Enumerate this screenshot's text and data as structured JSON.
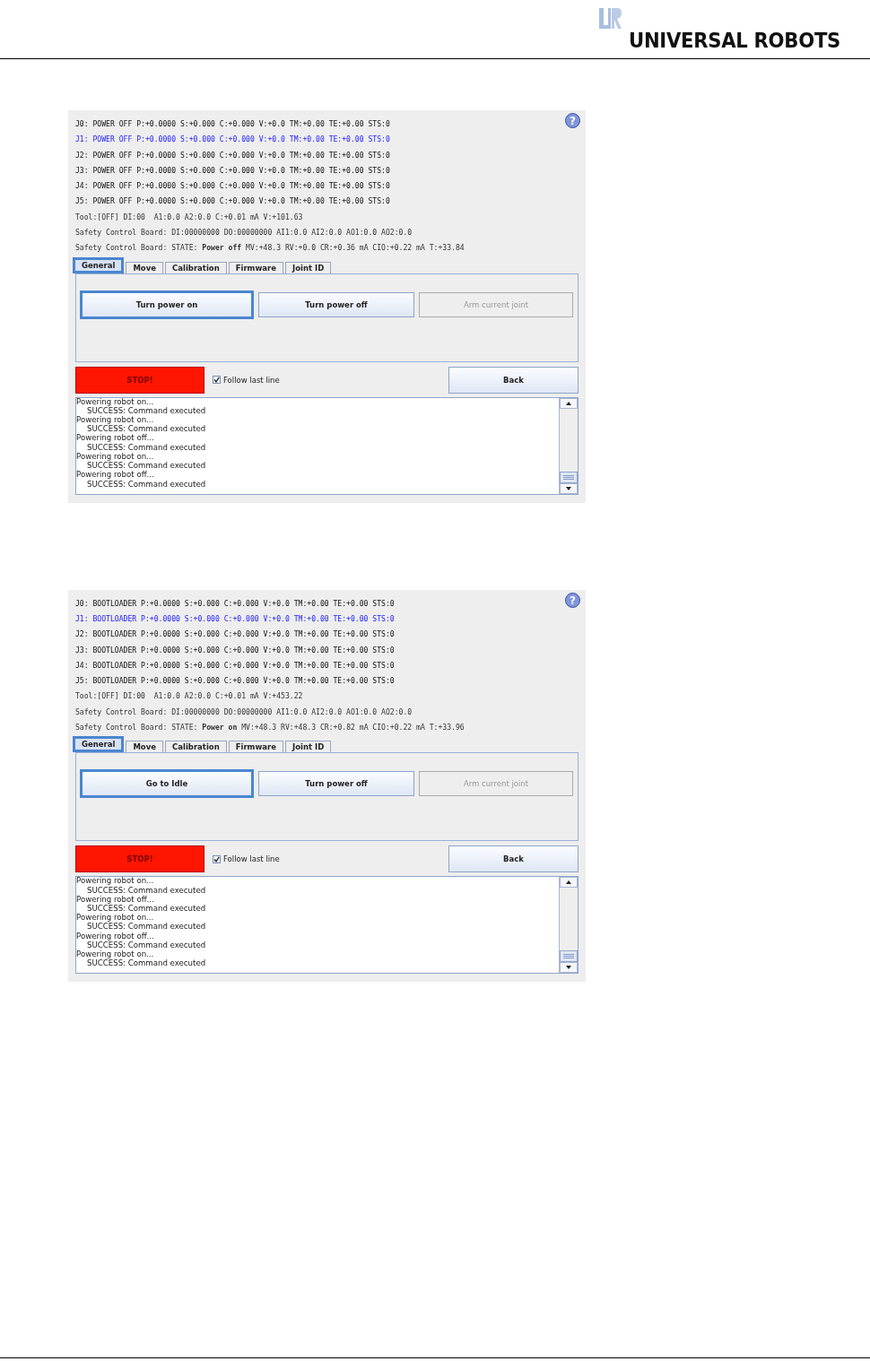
{
  "header": {
    "logo_text": "UNIVERSAL ROBOTS"
  },
  "screens": [
    {
      "help": "?",
      "joints": [
        {
          "text": "J0: POWER OFF P:+0.0000 S:+0.000 C:+0.000 V:+0.0 TM:+0.00 TE:+0.00 STS:0",
          "selected": false
        },
        {
          "text": "J1: POWER OFF P:+0.0000 S:+0.000 C:+0.000 V:+0.0 TM:+0.00 TE:+0.00 STS:0",
          "selected": true
        },
        {
          "text": "J2: POWER OFF P:+0.0000 S:+0.000 C:+0.000 V:+0.0 TM:+0.00 TE:+0.00 STS:0",
          "selected": false
        },
        {
          "text": "J3: POWER OFF P:+0.0000 S:+0.000 C:+0.000 V:+0.0 TM:+0.00 TE:+0.00 STS:0",
          "selected": false
        },
        {
          "text": "J4: POWER OFF P:+0.0000 S:+0.000 C:+0.000 V:+0.0 TM:+0.00 TE:+0.00 STS:0",
          "selected": false
        },
        {
          "text": "J5: POWER OFF P:+0.0000 S:+0.000 C:+0.000 V:+0.0 TM:+0.00 TE:+0.00 STS:0",
          "selected": false
        }
      ],
      "status_lines": [
        "Tool:[OFF] DI:00  A1:0.0 A2:0.0 C:+0.01 mA V:+101.63",
        "Safety Control Board: DI:00000000 DO:00000000 AI1:0.0 AI2:0.0 AO1:0.0 AO2:0.0",
        "Safety Control Board: STATE: **Power off** MV:+48.3 RV:+0.0 CR:+0.36 mA CIO:+0.22 mA T:+33.84"
      ],
      "tabs": [
        {
          "label": "General",
          "selected": true
        },
        {
          "label": "Move",
          "selected": false
        },
        {
          "label": "Calibration",
          "selected": false
        },
        {
          "label": "Firmware",
          "selected": false
        },
        {
          "label": "Joint ID",
          "selected": false
        }
      ],
      "buttons": [
        {
          "label": "Turn power on",
          "focused": true,
          "disabled": false
        },
        {
          "label": "Turn power off",
          "focused": false,
          "disabled": false
        },
        {
          "label": "Arm current joint",
          "focused": false,
          "disabled": true
        }
      ],
      "stop": "STOP!",
      "follow": {
        "label": "Follow last line",
        "checked": true
      },
      "back": "Back",
      "log": [
        {
          "text": "Powering robot on...",
          "kind": "action"
        },
        {
          "text": "SUCCESS: Command executed",
          "kind": "result"
        },
        {
          "text": "Powering robot on...",
          "kind": "action"
        },
        {
          "text": "SUCCESS: Command executed",
          "kind": "result"
        },
        {
          "text": "Powering robot off...",
          "kind": "action"
        },
        {
          "text": "SUCCESS: Command executed",
          "kind": "result"
        },
        {
          "text": "Powering robot on...",
          "kind": "action"
        },
        {
          "text": "SUCCESS: Command executed",
          "kind": "result"
        },
        {
          "text": "Powering robot off...",
          "kind": "action"
        },
        {
          "text": "SUCCESS: Command executed",
          "kind": "result"
        }
      ]
    },
    {
      "help": "?",
      "joints": [
        {
          "text": "J0: BOOTLOADER P:+0.0000 S:+0.000 C:+0.000 V:+0.0 TM:+0.00 TE:+0.00 STS:0",
          "selected": false
        },
        {
          "text": "J1: BOOTLOADER P:+0.0000 S:+0.000 C:+0.000 V:+0.0 TM:+0.00 TE:+0.00 STS:0",
          "selected": true
        },
        {
          "text": "J2: BOOTLOADER P:+0.0000 S:+0.000 C:+0.000 V:+0.0 TM:+0.00 TE:+0.00 STS:0",
          "selected": false
        },
        {
          "text": "J3: BOOTLOADER P:+0.0000 S:+0.000 C:+0.000 V:+0.0 TM:+0.00 TE:+0.00 STS:0",
          "selected": false
        },
        {
          "text": "J4: BOOTLOADER P:+0.0000 S:+0.000 C:+0.000 V:+0.0 TM:+0.00 TE:+0.00 STS:0",
          "selected": false
        },
        {
          "text": "J5: BOOTLOADER P:+0.0000 S:+0.000 C:+0.000 V:+0.0 TM:+0.00 TE:+0.00 STS:0",
          "selected": false
        }
      ],
      "status_lines": [
        "Tool:[OFF] DI:00  A1:0.0 A2:0.0 C:+0.01 mA V:+453.22",
        "Safety Control Board: DI:00000000 DO:00000000 AI1:0.0 AI2:0.0 AO1:0.0 AO2:0.0",
        "Safety Control Board: STATE: **Power on** MV:+48.3 RV:+48.3 CR:+0.82 mA CIO:+0.22 mA T:+33.96"
      ],
      "tabs": [
        {
          "label": "General",
          "selected": true
        },
        {
          "label": "Move",
          "selected": false
        },
        {
          "label": "Calibration",
          "selected": false
        },
        {
          "label": "Firmware",
          "selected": false
        },
        {
          "label": "Joint ID",
          "selected": false
        }
      ],
      "buttons": [
        {
          "label": "Go to Idle",
          "focused": true,
          "disabled": false
        },
        {
          "label": "Turn power off",
          "focused": false,
          "disabled": false
        },
        {
          "label": "Arm current joint",
          "focused": false,
          "disabled": true
        }
      ],
      "stop": "STOP!",
      "follow": {
        "label": "Follow last line",
        "checked": true
      },
      "back": "Back",
      "log": [
        {
          "text": "Powering robot on...",
          "kind": "action"
        },
        {
          "text": "SUCCESS: Command executed",
          "kind": "result"
        },
        {
          "text": "Powering robot off...",
          "kind": "action"
        },
        {
          "text": "SUCCESS: Command executed",
          "kind": "result"
        },
        {
          "text": "Powering robot on...",
          "kind": "action"
        },
        {
          "text": "SUCCESS: Command executed",
          "kind": "result"
        },
        {
          "text": "Powering robot off...",
          "kind": "action"
        },
        {
          "text": "SUCCESS: Command executed",
          "kind": "result"
        },
        {
          "text": "Powering robot on...",
          "kind": "action"
        },
        {
          "text": "SUCCESS: Command executed",
          "kind": "result"
        }
      ]
    }
  ]
}
